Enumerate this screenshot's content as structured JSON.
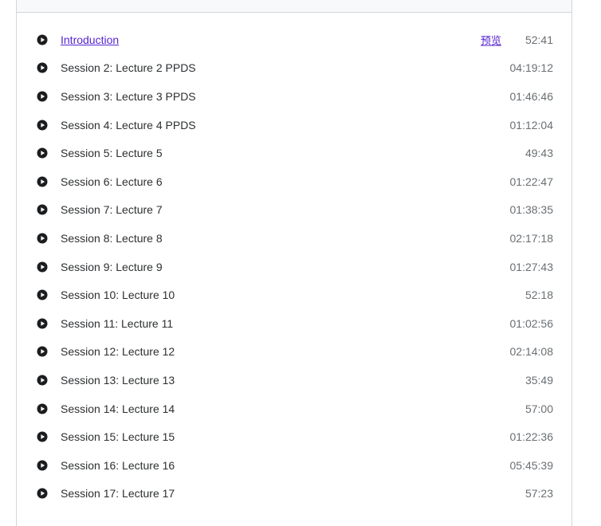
{
  "lectures": [
    {
      "title": "Introduction",
      "duration": "52:41",
      "preview": "预览"
    },
    {
      "title": "Session 2: Lecture 2 PPDS",
      "duration": "04:19:12"
    },
    {
      "title": "Session 3: Lecture 3 PPDS",
      "duration": "01:46:46"
    },
    {
      "title": "Session 4: Lecture 4 PPDS",
      "duration": "01:12:04"
    },
    {
      "title": "Session 5: Lecture 5",
      "duration": "49:43"
    },
    {
      "title": "Session 6: Lecture 6",
      "duration": "01:22:47"
    },
    {
      "title": "Session 7: Lecture 7",
      "duration": "01:38:35"
    },
    {
      "title": "Session 8: Lecture 8",
      "duration": "02:17:18"
    },
    {
      "title": "Session 9: Lecture 9",
      "duration": "01:27:43"
    },
    {
      "title": "Session 10: Lecture 10",
      "duration": "52:18"
    },
    {
      "title": "Session 11: Lecture 11",
      "duration": "01:02:56"
    },
    {
      "title": "Session 12: Lecture 12",
      "duration": "02:14:08"
    },
    {
      "title": "Session 13: Lecture 13",
      "duration": "35:49"
    },
    {
      "title": "Session 14: Lecture 14",
      "duration": "57:00"
    },
    {
      "title": "Session 15: Lecture 15",
      "duration": "01:22:36"
    },
    {
      "title": "Session 16: Lecture 16",
      "duration": "05:45:39"
    },
    {
      "title": "Session 17: Lecture 17",
      "duration": "57:23"
    }
  ],
  "icon": "play-circle-icon",
  "colors": {
    "link": "#5624d0",
    "text": "#2d2f31",
    "duration": "#6a6f73",
    "icon": "#1c1d1f",
    "border": "#d1d7dc"
  }
}
